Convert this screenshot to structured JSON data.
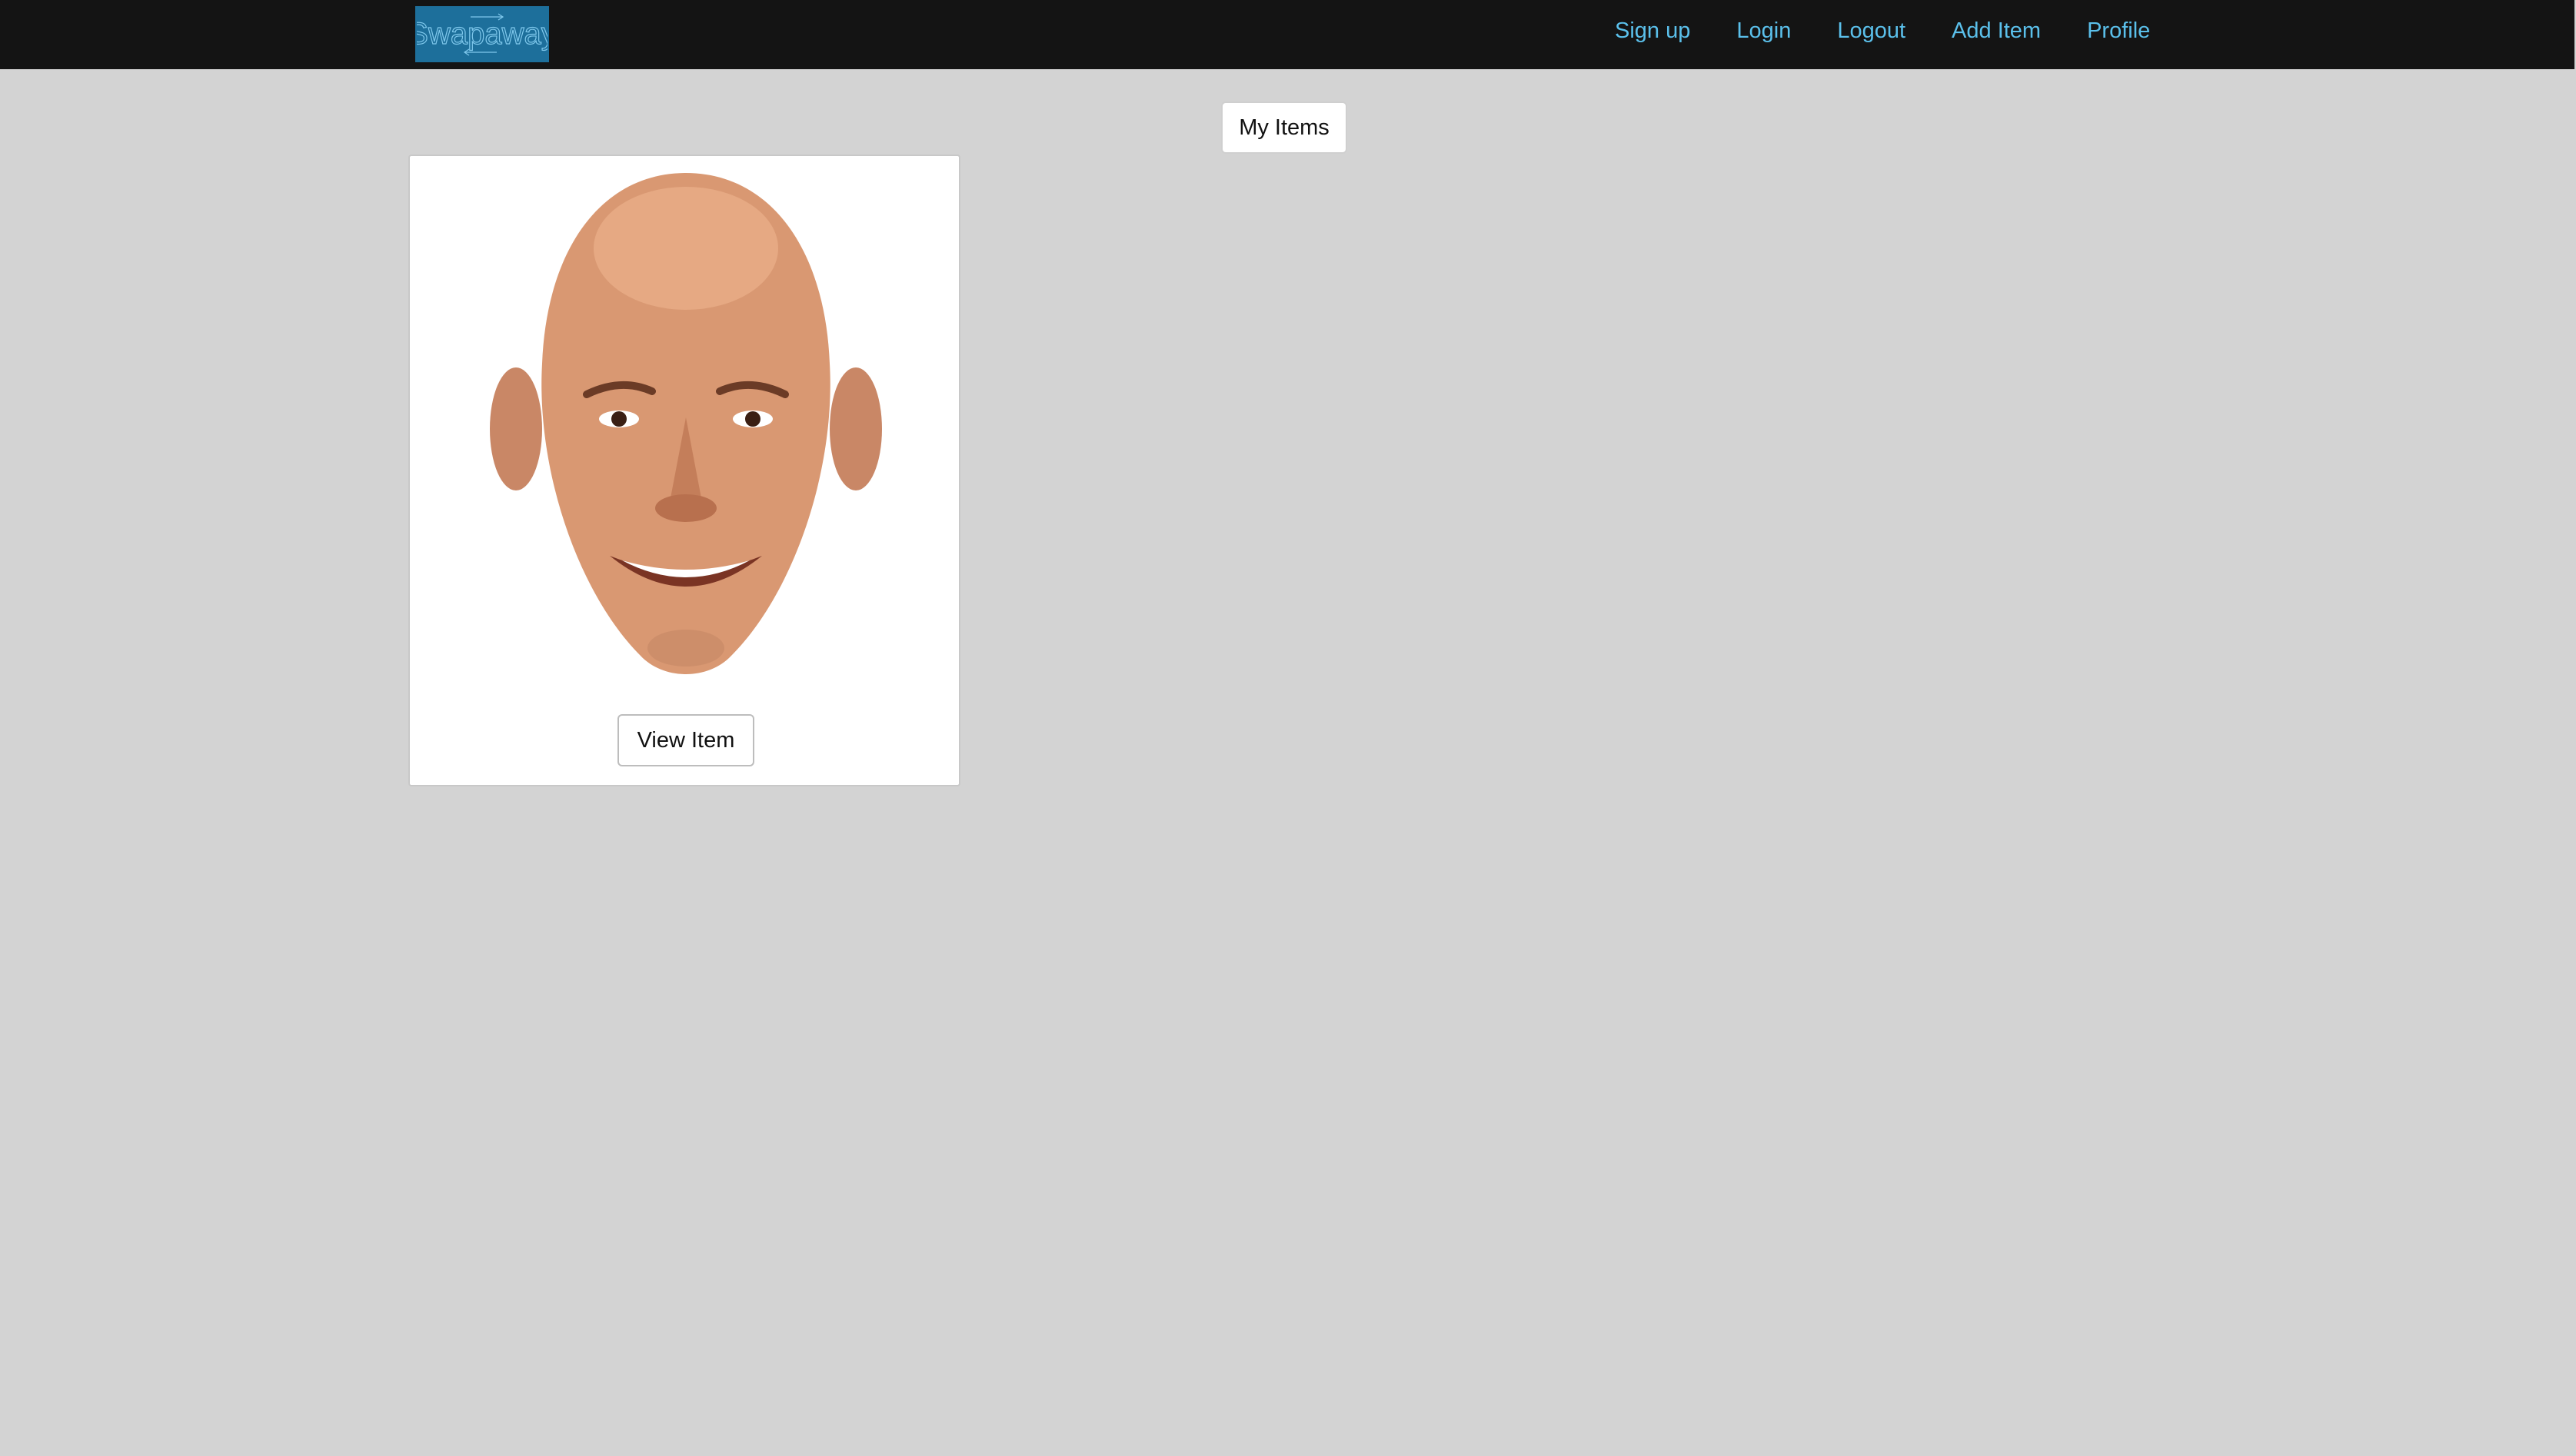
{
  "header": {
    "logo_text": "Swapaway",
    "brand_color": "#1d6f9b",
    "nav": [
      {
        "label": "Sign up"
      },
      {
        "label": "Login"
      },
      {
        "label": "Logout"
      },
      {
        "label": "Add Item"
      },
      {
        "label": "Profile"
      }
    ],
    "link_color": "#5bc0eb"
  },
  "main": {
    "my_items_label": "My Items",
    "items": [
      {
        "image": "face-photo",
        "button_label": "View Item"
      }
    ]
  }
}
